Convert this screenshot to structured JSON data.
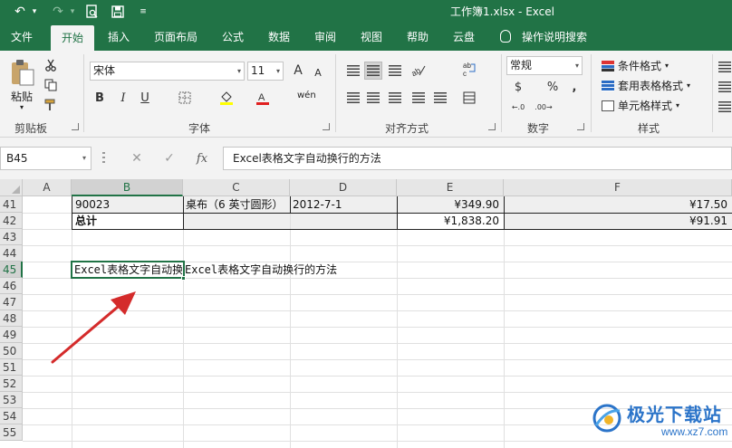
{
  "title_bar": {
    "title": "工作簿1.xlsx  -  Excel"
  },
  "quick_access": {
    "undo_icon": "↶",
    "undo_dd": "▾",
    "redo_icon": "↷",
    "redo_dd": "▾",
    "preview_icon": "⎘",
    "save_icon": "💾",
    "customize_icon": "≡"
  },
  "tabs": [
    {
      "label": "文件"
    },
    {
      "label": "开始"
    },
    {
      "label": "插入"
    },
    {
      "label": "页面布局"
    },
    {
      "label": "公式"
    },
    {
      "label": "数据"
    },
    {
      "label": "审阅"
    },
    {
      "label": "视图"
    },
    {
      "label": "帮助"
    },
    {
      "label": "云盘"
    },
    {
      "label": "操作说明搜索"
    }
  ],
  "ribbon": {
    "clipboard": {
      "paste": "粘贴",
      "label": "剪贴板",
      "paste_dd": "▾"
    },
    "font": {
      "name": "宋体",
      "size": "11",
      "grow": "A",
      "shrink": "A",
      "bold": "B",
      "italic": "I",
      "underline": "U",
      "label": "字体",
      "phonetic": "wén",
      "dd": "▾"
    },
    "alignment": {
      "label": "对齐方式"
    },
    "number": {
      "format": "常规",
      "percent": "%",
      "comma": ",",
      "label": "数字",
      "currency": "$",
      "inc": "←.0",
      "dec": ".00→"
    },
    "styles": {
      "cond": "条件格式",
      "table": "套用表格格式",
      "cell": "单元格样式",
      "label": "样式",
      "dd": "▾"
    },
    "editing": {
      "abc": "ab",
      "c": "c"
    }
  },
  "formula_bar": {
    "name_box": "B45",
    "name_dd": "▾",
    "cancel": "✕",
    "enter": "✓",
    "fx": "fx",
    "content": "Excel表格文字自动换行的方法"
  },
  "columns": [
    "A",
    "B",
    "C",
    "D",
    "E",
    "F"
  ],
  "rows": [
    "41",
    "42",
    "43",
    "44",
    "45",
    "46",
    "47",
    "48",
    "49",
    "50",
    "51",
    "52",
    "53",
    "54",
    "55"
  ],
  "cells": {
    "B41": "90023",
    "C41": "桌布（6 英寸圆形）",
    "D41": "2012-7-1",
    "E41": "¥349.90",
    "F41": "¥17.50",
    "B42": "总计",
    "E42": "¥1,838.20",
    "F42": "¥91.91",
    "B45": "Excel表格文字自动换行的方法",
    "C45_overflow": "Excel表格文字自动换行的方法"
  },
  "watermark": {
    "text": "极光下载站",
    "url": "www.xz7.com"
  },
  "colors": {
    "excel_green": "#217346",
    "arrow_red": "#d42b2b",
    "watermark_blue": "#2b74c9"
  }
}
